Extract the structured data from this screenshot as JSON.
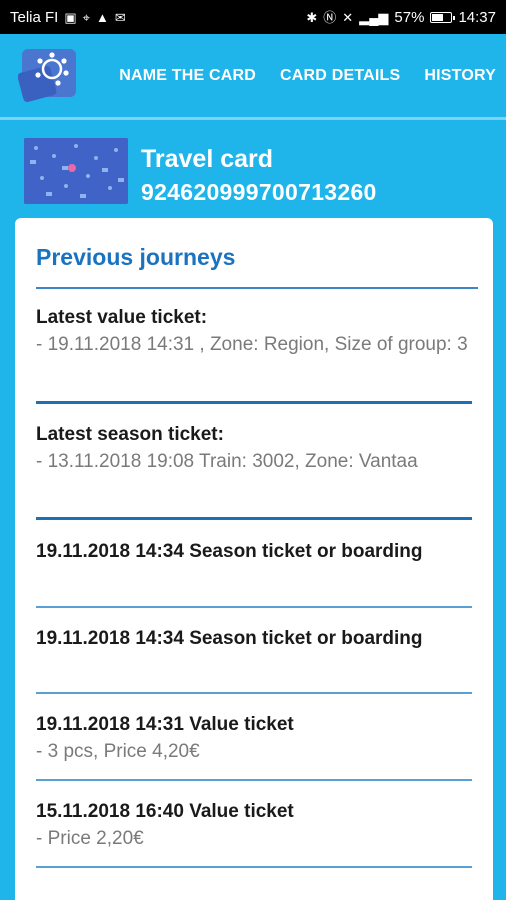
{
  "status_bar": {
    "carrier": "Telia FI",
    "battery": "57%",
    "time": "14:37"
  },
  "nav": {
    "name_card": "NAME THE CARD",
    "card_details": "CARD DETAILS",
    "history": "HISTORY"
  },
  "card": {
    "title": "Travel card",
    "number": "9246209997007132​60"
  },
  "panel": {
    "title": "Previous journeys",
    "value_ticket": {
      "heading": "Latest value ticket:",
      "details": "- 19.11.2018 14:31 , Zone: Region, Size of group: 3"
    },
    "season_ticket": {
      "heading": "Latest season ticket:",
      "details": "- 13.11.2018 19:08 Train: 3002, Zone: Vantaa"
    },
    "history": [
      {
        "heading": "19.11.2018 14:34 Season ticket or boarding",
        "details": ""
      },
      {
        "heading": "19.11.2018 14:34 Season ticket or boarding",
        "details": ""
      },
      {
        "heading": "19.11.2018 14:31 Value ticket",
        "details": "- 3 pcs, Price 4,20€"
      },
      {
        "heading": "15.11.2018 16:40 Value ticket",
        "details": "- Price 2,20€"
      }
    ]
  },
  "colors": {
    "header_bg": "#1fb4ea",
    "title_blue": "#1a73c0",
    "rule_blue": "#1f6fb4"
  }
}
